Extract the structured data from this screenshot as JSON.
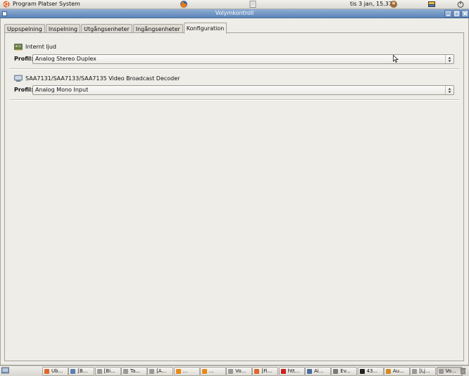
{
  "top_panel": {
    "menus": [
      "Program",
      "Platser",
      "System"
    ],
    "clock": "tis  3 jan, 15.37"
  },
  "window": {
    "title": "Volymkontroll",
    "tabs": [
      "Uppspelning",
      "Inspelning",
      "Utgångsenheter",
      "Ingångsenheter",
      "Konfiguration"
    ],
    "active_tab": "Konfiguration",
    "devices": [
      {
        "name": "Internt ljud",
        "profile_label": "Profil:",
        "profile_value": "Analog Stereo Duplex"
      },
      {
        "name": "SAA7131/SAA7133/SAA7135 Video Broadcast Decoder",
        "profile_label": "Profil:",
        "profile_value": "Analog Mono Input"
      }
    ]
  },
  "taskbar": {
    "tasks": [
      {
        "label": "Ub...",
        "color": "#e0662a"
      },
      {
        "label": "[B...",
        "color": "#5b7fb5"
      },
      {
        "label": "[Bi...",
        "color": "#9a9a9a"
      },
      {
        "label": "Ta...",
        "color": "#9a9a9a"
      },
      {
        "label": "[A...",
        "color": "#9a9a9a"
      },
      {
        "label": "...",
        "color": "#e88a1a"
      },
      {
        "label": "...",
        "color": "#e88a1a"
      },
      {
        "label": "Vo...",
        "color": "#9a9a9a"
      },
      {
        "label": "[Fi...",
        "color": "#e0662a"
      },
      {
        "label": "htt...",
        "color": "#cc1f1f"
      },
      {
        "label": "Ai...",
        "color": "#4a6da0"
      },
      {
        "label": "Ev...",
        "color": "#7a7a7a"
      },
      {
        "label": "43...",
        "color": "#222222"
      },
      {
        "label": "Au...",
        "color": "#d68a20"
      },
      {
        "label": "[Lj...",
        "color": "#9a9a9a"
      },
      {
        "label": "Vo...",
        "color": "#9a9a9a"
      }
    ]
  },
  "colors": {
    "titlebar": "#6e92c2",
    "panel": "#e6e4de",
    "window_bg": "#eeede8"
  }
}
